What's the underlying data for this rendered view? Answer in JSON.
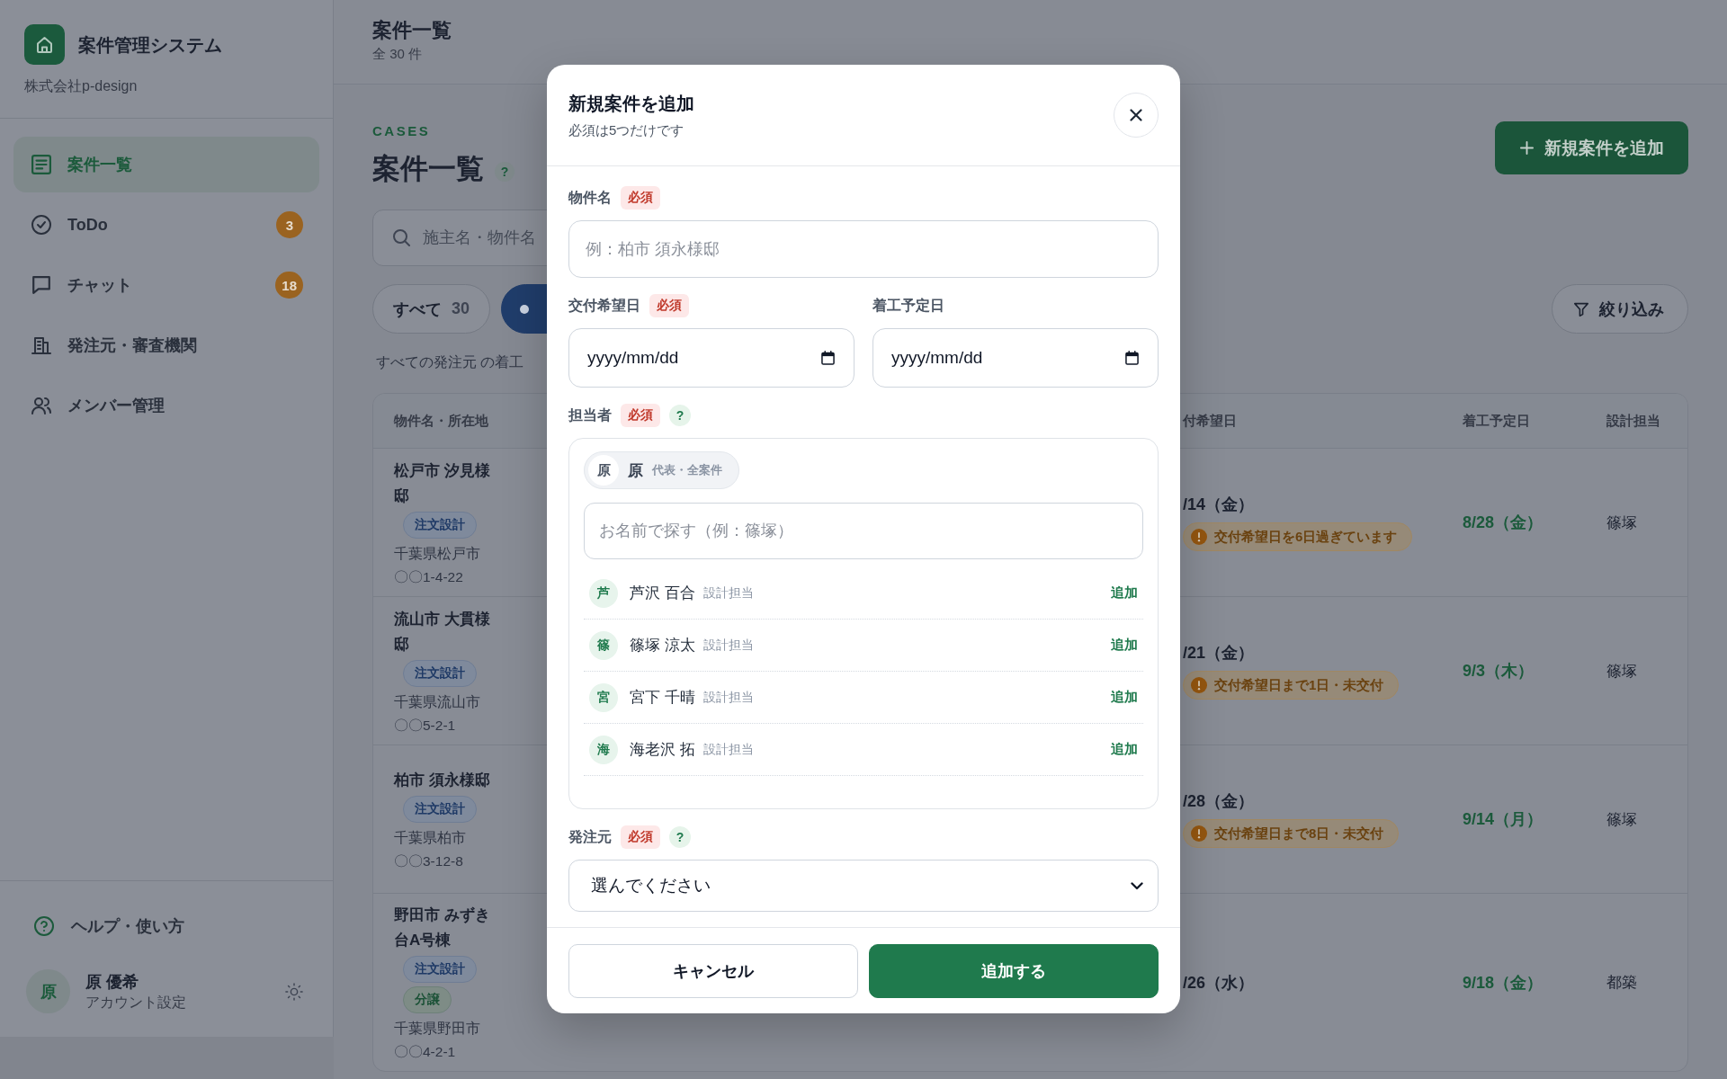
{
  "sidebar": {
    "brand": {
      "title": "案件管理システム",
      "company": "株式会社p-design"
    },
    "nav": [
      {
        "kind": "list",
        "label": "案件一覧",
        "selected": true
      },
      {
        "kind": "check",
        "label": "ToDo",
        "selected": false,
        "badge": "3"
      },
      {
        "kind": "chat",
        "label": "チャット",
        "selected": false,
        "badge": "18"
      },
      {
        "kind": "building",
        "label": "発注元・審査機関",
        "selected": false
      },
      {
        "kind": "people",
        "label": "メンバー管理",
        "selected": false
      }
    ],
    "help": "ヘルプ・使い方",
    "user": {
      "avatar": "原",
      "name": "原 優希",
      "link": "アカウント設定"
    }
  },
  "top_bar": {
    "title": "案件一覧",
    "count": "全 30 件"
  },
  "page": {
    "eyebrow": "CASES",
    "title": "案件一覧",
    "help": "?",
    "add_button": "新規案件を追加"
  },
  "search": {
    "placeholder": "施主名・物件名"
  },
  "filters": [
    {
      "label": "すべて",
      "count": "30",
      "selected": false
    },
    {
      "selected": true
    }
  ],
  "filter_button": "絞り込み",
  "summary": "すべての発注元 の着工",
  "table": {
    "columns": [
      {
        "label": "物件名・所在地"
      },
      {
        "label": "付希望日"
      },
      {
        "label": "着工予定日"
      },
      {
        "label": "設計担当"
      }
    ],
    "rows": [
      {
        "name": "松戸市 汐見様邸",
        "tags": [
          {
            "kind": "order",
            "label": "注文設計"
          }
        ],
        "city": "千葉県松戸市",
        "street": "〇〇1-4-22",
        "due": "/14（金）",
        "alert": "交付希望日を6日過ぎています",
        "start": "8/28（金）",
        "designer": "篠塚"
      },
      {
        "name": "流山市 大貫様邸",
        "tags": [
          {
            "kind": "order",
            "label": "注文設計"
          }
        ],
        "city": "千葉県流山市",
        "street": "〇〇5-2-1",
        "due": "/21（金）",
        "alert": "交付希望日まで1日・未交付",
        "start": "9/3（木）",
        "designer": "篠塚"
      },
      {
        "name": "柏市 須永様邸",
        "tags": [
          {
            "kind": "order",
            "label": "注文設計"
          }
        ],
        "city": "千葉県柏市",
        "street": "〇〇3-12-8",
        "due": "/28（金）",
        "alert": "交付希望日まで8日・未交付",
        "start": "9/14（月）",
        "designer": "篠塚"
      },
      {
        "name": "野田市 みずき台A号棟",
        "tags": [
          {
            "kind": "order",
            "label": "注文設計"
          },
          {
            "kind": "sale",
            "label": "分譲"
          }
        ],
        "city": "千葉県野田市",
        "street": "〇〇4-2-1",
        "due": "/26（水）",
        "start": "9/18（金）",
        "designer": "都築"
      }
    ]
  },
  "dialog": {
    "title": "新規案件を追加",
    "subtitle": "必須は5つだけです",
    "name_field": {
      "label": "物件名",
      "badge": "必須",
      "placeholder": "例：柏市 須永様邸"
    },
    "date_fields": [
      {
        "label": "交付希望日",
        "badge": "必須",
        "placeholder": "yyyy/mm/dd"
      },
      {
        "label": "着工予定日",
        "placeholder": "yyyy/mm/dd"
      }
    ],
    "assignee": {
      "label": "担当者",
      "badge": "必須",
      "help": "?",
      "chosen": [
        {
          "avatar": "原",
          "name": "原",
          "role": "代表・全案件"
        }
      ],
      "search_placeholder": "お名前で探す（例：篠塚）",
      "members": [
        {
          "avatar": "芦",
          "name": "芦沢 百合",
          "role": "設計担当",
          "action": "追加"
        },
        {
          "avatar": "篠",
          "name": "篠塚 涼太",
          "role": "設計担当",
          "action": "追加"
        },
        {
          "avatar": "宮",
          "name": "宮下 千晴",
          "role": "設計担当",
          "action": "追加"
        },
        {
          "avatar": "海",
          "name": "海老沢 拓",
          "role": "設計担当",
          "action": "追加"
        }
      ]
    },
    "client_field": {
      "label": "発注元",
      "badge": "必須",
      "help": "?",
      "value": "選んでください"
    },
    "buttons": [
      {
        "kind": "secondary",
        "label": "キャンセル"
      },
      {
        "kind": "primary",
        "label": "追加する"
      }
    ]
  }
}
